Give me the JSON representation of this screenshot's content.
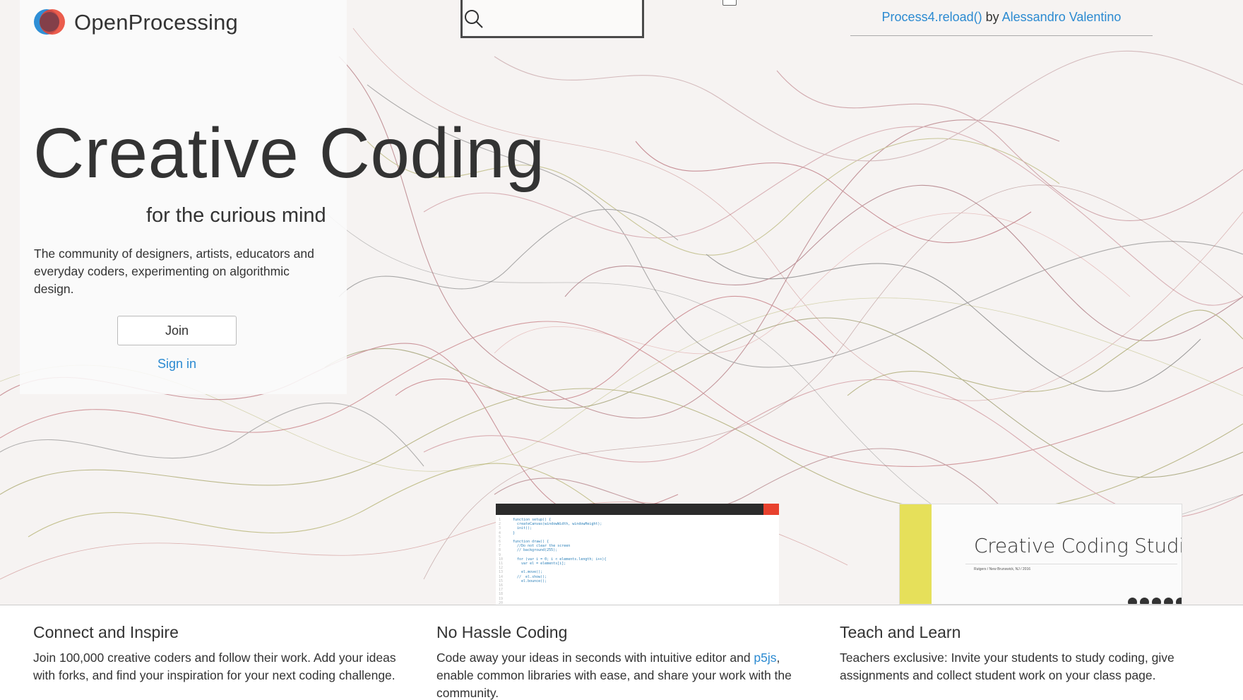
{
  "brand": {
    "name": "OpenProcessing"
  },
  "hero": {
    "headline": "Creative Coding",
    "tagline": "for the curious mind",
    "description": "The community of designers, artists, educators and everyday coders, experimenting on algorithmic design.",
    "join_label": "Join",
    "signin_label": "Sign in"
  },
  "search": {
    "placeholder": "",
    "value": ""
  },
  "featured": {
    "sketch_title": "Process4.reload()",
    "by": "by",
    "author": "Alessandro Valentino"
  },
  "studio_preview": {
    "title": "Creative Coding Studio",
    "subtitle": "Rutgers / New Brunswick, NJ / 2016"
  },
  "features": [
    {
      "title": "Connect and Inspire",
      "text": "Join 100,000 creative coders and follow their work. Add your ideas with forks, and find your inspiration for your next coding challenge."
    },
    {
      "title": "No Hassle Coding",
      "text_before": "Code away your ideas in seconds with intuitive editor and ",
      "link": "p5js",
      "text_after": ", enable common libraries with ease, and share your work with the community."
    },
    {
      "title": "Teach and Learn",
      "text": "Teachers exclusive: Invite your students to study coding, give assignments and collect student work on your class page."
    }
  ],
  "colors": {
    "link": "#2b8ad1",
    "text": "#333333",
    "save_red": "#e8412e",
    "studio_yellow": "#e6e05a"
  }
}
